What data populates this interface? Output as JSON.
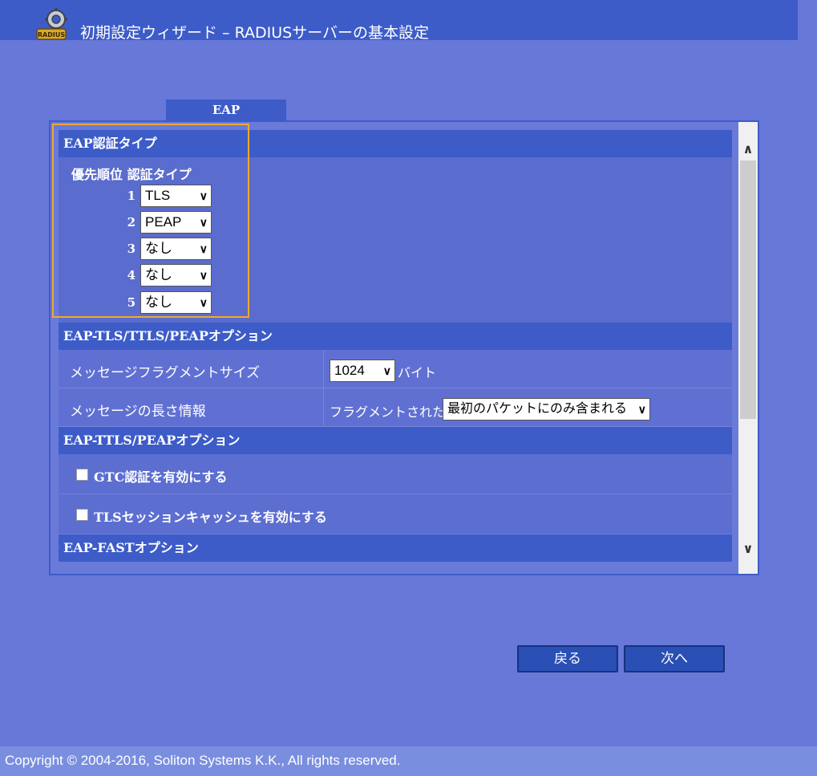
{
  "header": {
    "title": "初期設定ウィザード – RADIUSサーバーの基本設定",
    "logo_text": "RADIUS"
  },
  "tab": {
    "label": "EAP"
  },
  "eap_auth_type": {
    "section_title": "EAP認証タイプ",
    "col_priority": "優先順位",
    "col_type": "認証タイプ",
    "rows": [
      {
        "priority": "1",
        "value": "TLS"
      },
      {
        "priority": "2",
        "value": "PEAP"
      },
      {
        "priority": "3",
        "value": "なし"
      },
      {
        "priority": "4",
        "value": "なし"
      },
      {
        "priority": "5",
        "value": "なし"
      }
    ]
  },
  "tls_options": {
    "section_title": "EAP-TLS/TTLS/PEAPオプション",
    "fragment_label": "メッセージフラグメントサイズ",
    "fragment_value": "1024",
    "fragment_unit": "バイト",
    "length_label": "メッセージの長さ情報",
    "length_prefix": "フラグメントされた",
    "length_value": "最初のパケットにのみ含まれる"
  },
  "ttls_options": {
    "section_title": "EAP-TTLS/PEAPオプション",
    "gtc_label": "GTC認証を有効にする",
    "gtc_checked": false,
    "tls_cache_label": "TLSセッションキャッシュを有効にする",
    "tls_cache_checked": false
  },
  "fast_options": {
    "section_title": "EAP-FASTオプション"
  },
  "buttons": {
    "back": "戻る",
    "next": "次へ"
  },
  "footer": {
    "copyright": "Copyright © 2004-2016, Soliton Systems K.K., All rights reserved."
  },
  "colors": {
    "background": "#6878d8",
    "header": "#3d5cc8",
    "highlight": "#f0a830"
  }
}
